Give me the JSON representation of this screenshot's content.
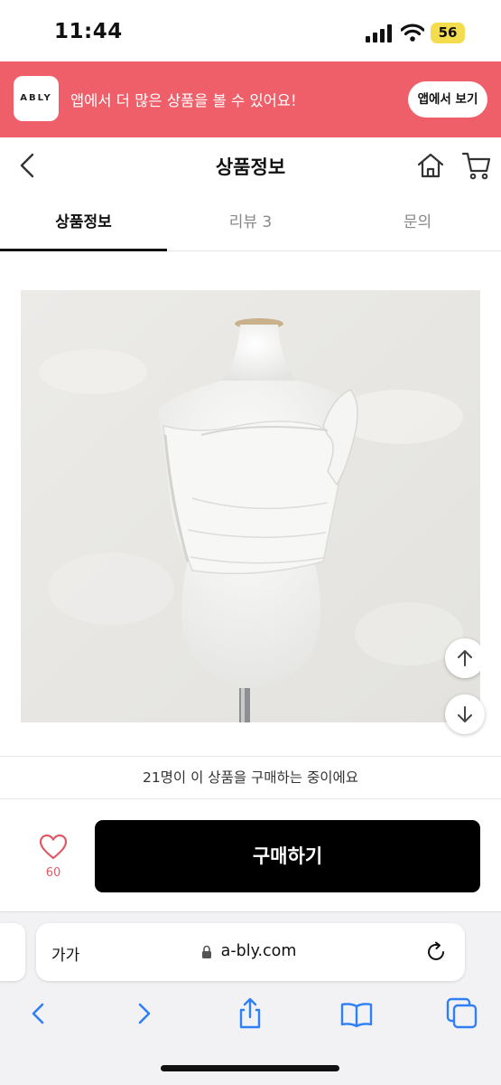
{
  "status_bar": {
    "time": "11:44",
    "battery": "56"
  },
  "promo": {
    "logo_text": "ABLY",
    "message": "앱에서 더 많은 상품을 볼 수 있어요!",
    "button_label": "앱에서 보기"
  },
  "header": {
    "title": "상품정보"
  },
  "tabs": [
    {
      "label": "상품정보",
      "active": true
    },
    {
      "label": "리뷰 3",
      "active": false
    },
    {
      "label": "문의",
      "active": false
    }
  ],
  "notice": {
    "text": "21명이 이 상품을 구매하는 중이에요"
  },
  "purchase": {
    "like_count": "60",
    "buy_label": "구매하기"
  },
  "browser": {
    "aa_label": "가가",
    "url": "a-bly.com"
  },
  "colors": {
    "brand": "#ef5f69",
    "like": "#e05a66",
    "buy_button": "#000000",
    "battery": "#f3dd4f"
  },
  "icons": [
    "signal-icon",
    "wifi-icon",
    "back-icon",
    "home-icon",
    "cart-icon",
    "arrow-up-icon",
    "arrow-down-icon",
    "heart-icon",
    "lock-icon",
    "reload-icon",
    "share-icon",
    "bookmarks-icon",
    "tabs-icon"
  ]
}
